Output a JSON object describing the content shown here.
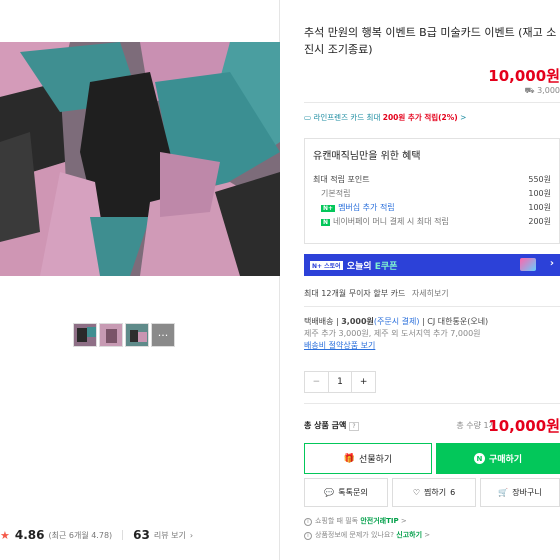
{
  "product": {
    "title": "추석 만원의 행복 이벤트 B급 미술카드 이벤트 (재고 소진시 조기종료)",
    "price": "10,000",
    "price_unit": "원",
    "shipping_mini": "3,000"
  },
  "point_line": {
    "text": "라인프렌즈 카드 최대",
    "highlight": "200원 추가 적립(2%)",
    "chev": ">"
  },
  "benefit": {
    "title": "유캔매직님만을 위한 혜택",
    "max_label": "최대 적립 포인트",
    "max_value": "550원",
    "rows": [
      {
        "label": "기본적립",
        "value": "100원"
      },
      {
        "label": "멤버십 추가 적립",
        "value": "100원"
      },
      {
        "label": "네이버페이 머니 결제 시 최대 적립",
        "value": "200원"
      }
    ]
  },
  "banner": {
    "chip": "N+ 스토어",
    "text_a": "오늘의",
    "text_b": "E쿠폰",
    "chev": "›"
  },
  "install": {
    "label": "최대 12개월 무이자 할부 카드",
    "link": "자세히보기"
  },
  "shipping": {
    "line1_a": "택배배송",
    "line1_b": "3,000원",
    "line1_c": "(주문시 결제)",
    "line1_d": "CJ 대한통운(오네)",
    "line2": "제주 추가 3,000원, 제주 외 도서지역 추가 7,000원",
    "line3": "배송비 절약상품 보기"
  },
  "quantity": {
    "minus": "−",
    "value": "1",
    "plus": "+"
  },
  "total": {
    "label": "총 상품 금액",
    "q": "?",
    "count": "총 수량 1개",
    "price": "10,000",
    "unit": "원"
  },
  "buttons": {
    "gift": "선물하기",
    "buy": "구매하기",
    "talk": "톡톡문의",
    "wish": "찜하기",
    "wish_count": "6",
    "cart": "장바구니"
  },
  "notices": {
    "n1_a": "쇼핑할 때 필독",
    "n1_b": "안전거래TIP",
    "n2_a": "상품정보에 문제가 있나요?",
    "n2_b": "신고하기"
  },
  "rating": {
    "score": "4.86",
    "sub": "(최근 6개월 4.78)",
    "reviews": "63",
    "reviews_label": "리뷰 보기"
  },
  "thumbs": {
    "more": "···"
  },
  "colors": {
    "accent_green": "#03c75a",
    "price_red": "#e4001b",
    "banner_blue": "#2c41d8"
  }
}
